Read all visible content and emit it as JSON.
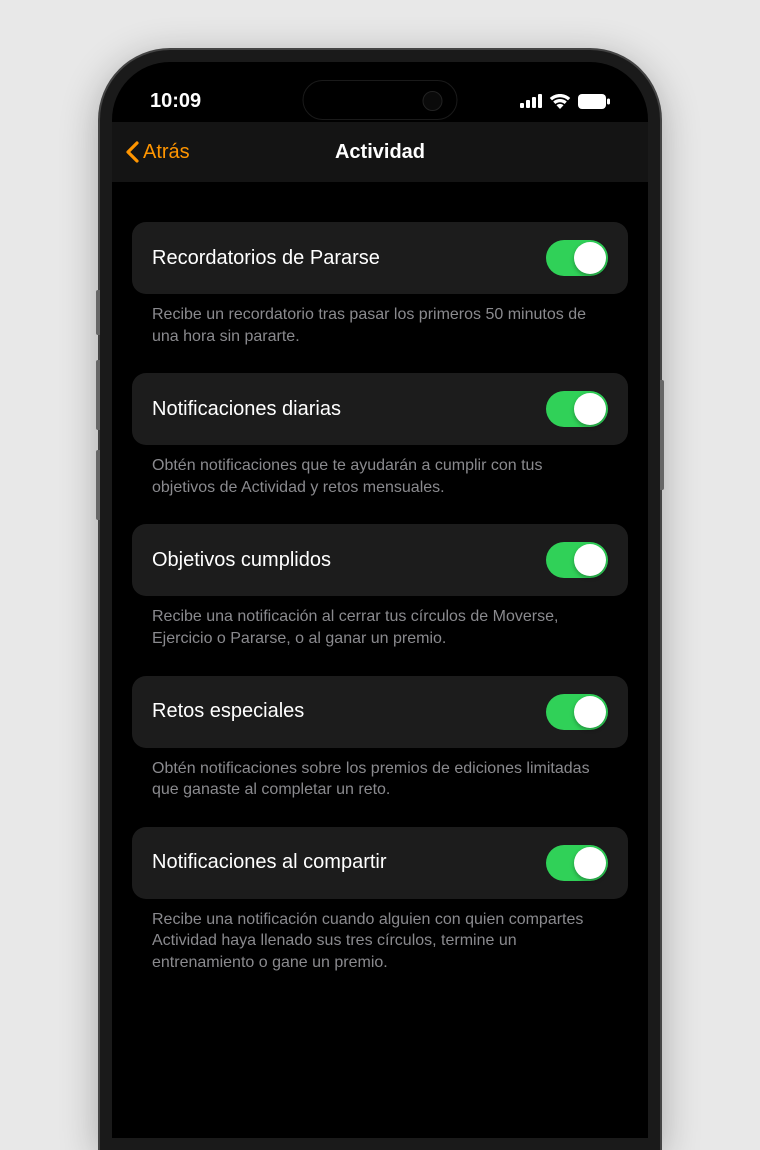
{
  "statusBar": {
    "time": "10:09"
  },
  "nav": {
    "back": "Atrás",
    "title": "Actividad"
  },
  "settings": [
    {
      "label": "Recordatorios de Pararse",
      "desc": "Recibe un recordatorio tras pasar los primeros 50 minutos de una hora sin pararte.",
      "on": true
    },
    {
      "label": "Notificaciones diarias",
      "desc": "Obtén notificaciones que te ayudarán a cumplir con tus objetivos de Actividad y retos mensuales.",
      "on": true
    },
    {
      "label": "Objetivos cumplidos",
      "desc": "Recibe una notificación al cerrar tus círculos de Moverse, Ejercicio o Pararse, o al ganar un premio.",
      "on": true
    },
    {
      "label": "Retos especiales",
      "desc": "Obtén notificaciones sobre los premios de ediciones limitadas que ganaste al completar un reto.",
      "on": true
    },
    {
      "label": "Notificaciones al compartir",
      "desc": "Recibe una notificación cuando alguien con quien compartes Actividad haya llenado sus tres círculos, termine un entrenamiento o gane un premio.",
      "on": true
    }
  ]
}
